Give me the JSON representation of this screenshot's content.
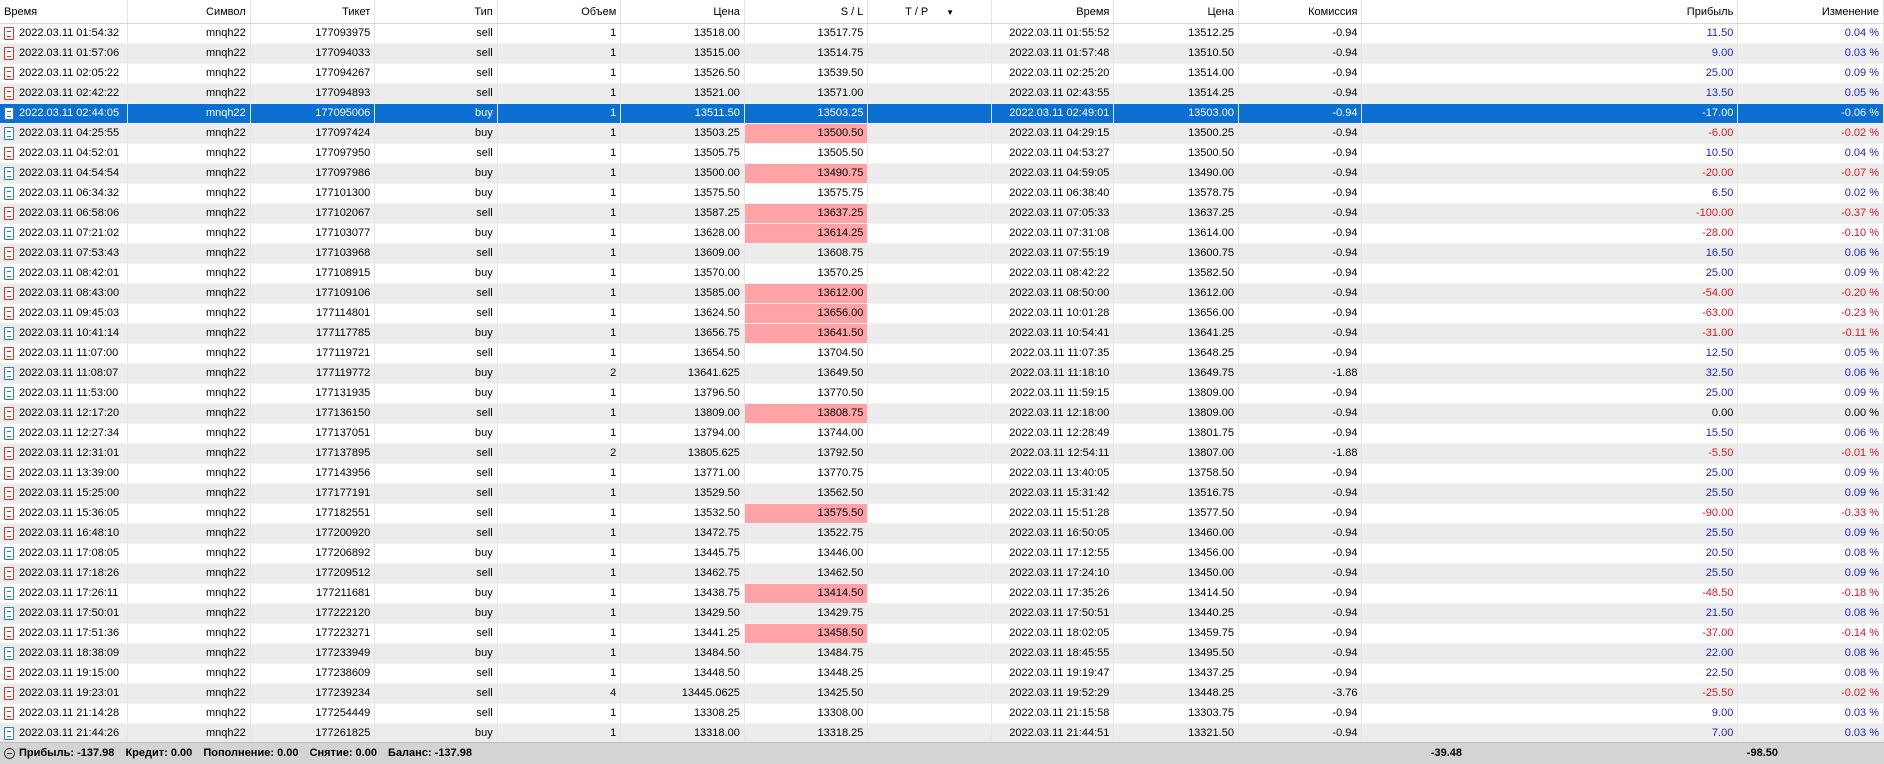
{
  "columns": [
    "Время",
    "Символ",
    "Тикет",
    "Тип",
    "Объем",
    "Цена",
    "S / L",
    "T / P",
    "Время",
    "Цена",
    "Комиссия",
    "Прибыль",
    "Изменение"
  ],
  "sort_indicator": "▼",
  "rows": [
    [
      "2022.03.11 01:54:32",
      "mnqh22",
      "177093975",
      "sell",
      "1",
      "13518.00",
      "13517.75",
      "",
      "2022.03.11 01:55:52",
      "13512.25",
      "-0.94",
      "11.50",
      "0.04 %"
    ],
    [
      "2022.03.11 01:57:06",
      "mnqh22",
      "177094033",
      "sell",
      "1",
      "13515.00",
      "13514.75",
      "",
      "2022.03.11 01:57:48",
      "13510.50",
      "-0.94",
      "9.00",
      "0.03 %"
    ],
    [
      "2022.03.11 02:05:22",
      "mnqh22",
      "177094267",
      "sell",
      "1",
      "13526.50",
      "13539.50",
      "",
      "2022.03.11 02:25:20",
      "13514.00",
      "-0.94",
      "25.00",
      "0.09 %"
    ],
    [
      "2022.03.11 02:42:22",
      "mnqh22",
      "177094893",
      "sell",
      "1",
      "13521.00",
      "13571.00",
      "",
      "2022.03.11 02:43:55",
      "13514.25",
      "-0.94",
      "13.50",
      "0.05 %"
    ],
    [
      "2022.03.11 02:44:05",
      "mnqh22",
      "177095006",
      "buy",
      "1",
      "13511.50",
      "13503.25",
      "",
      "2022.03.11 02:49:01",
      "13503.00",
      "-0.94",
      "-17.00",
      "-0.06 %"
    ],
    [
      "2022.03.11 04:25:55",
      "mnqh22",
      "177097424",
      "buy",
      "1",
      "13503.25",
      "13500.50",
      "",
      "2022.03.11 04:29:15",
      "13500.25",
      "-0.94",
      "-6.00",
      "-0.02 %"
    ],
    [
      "2022.03.11 04:52:01",
      "mnqh22",
      "177097950",
      "sell",
      "1",
      "13505.75",
      "13505.50",
      "",
      "2022.03.11 04:53:27",
      "13500.50",
      "-0.94",
      "10.50",
      "0.04 %"
    ],
    [
      "2022.03.11 04:54:54",
      "mnqh22",
      "177097986",
      "buy",
      "1",
      "13500.00",
      "13490.75",
      "",
      "2022.03.11 04:59:05",
      "13490.00",
      "-0.94",
      "-20.00",
      "-0.07 %"
    ],
    [
      "2022.03.11 06:34:32",
      "mnqh22",
      "177101300",
      "buy",
      "1",
      "13575.50",
      "13575.75",
      "",
      "2022.03.11 06:38:40",
      "13578.75",
      "-0.94",
      "6.50",
      "0.02 %"
    ],
    [
      "2022.03.11 06:58:06",
      "mnqh22",
      "177102067",
      "sell",
      "1",
      "13587.25",
      "13637.25",
      "",
      "2022.03.11 07:05:33",
      "13637.25",
      "-0.94",
      "-100.00",
      "-0.37 %"
    ],
    [
      "2022.03.11 07:21:02",
      "mnqh22",
      "177103077",
      "buy",
      "1",
      "13628.00",
      "13614.25",
      "",
      "2022.03.11 07:31:08",
      "13614.00",
      "-0.94",
      "-28.00",
      "-0.10 %"
    ],
    [
      "2022.03.11 07:53:43",
      "mnqh22",
      "177103968",
      "sell",
      "1",
      "13609.00",
      "13608.75",
      "",
      "2022.03.11 07:55:19",
      "13600.75",
      "-0.94",
      "16.50",
      "0.06 %"
    ],
    [
      "2022.03.11 08:42:01",
      "mnqh22",
      "177108915",
      "buy",
      "1",
      "13570.00",
      "13570.25",
      "",
      "2022.03.11 08:42:22",
      "13582.50",
      "-0.94",
      "25.00",
      "0.09 %"
    ],
    [
      "2022.03.11 08:43:00",
      "mnqh22",
      "177109106",
      "sell",
      "1",
      "13585.00",
      "13612.00",
      "",
      "2022.03.11 08:50:00",
      "13612.00",
      "-0.94",
      "-54.00",
      "-0.20 %"
    ],
    [
      "2022.03.11 09:45:03",
      "mnqh22",
      "177114801",
      "sell",
      "1",
      "13624.50",
      "13656.00",
      "",
      "2022.03.11 10:01:28",
      "13656.00",
      "-0.94",
      "-63.00",
      "-0.23 %"
    ],
    [
      "2022.03.11 10:41:14",
      "mnqh22",
      "177117785",
      "buy",
      "1",
      "13656.75",
      "13641.50",
      "",
      "2022.03.11 10:54:41",
      "13641.25",
      "-0.94",
      "-31.00",
      "-0.11 %"
    ],
    [
      "2022.03.11 11:07:00",
      "mnqh22",
      "177119721",
      "sell",
      "1",
      "13654.50",
      "13704.50",
      "",
      "2022.03.11 11:07:35",
      "13648.25",
      "-0.94",
      "12.50",
      "0.05 %"
    ],
    [
      "2022.03.11 11:08:07",
      "mnqh22",
      "177119772",
      "buy",
      "2",
      "13641.625",
      "13649.50",
      "",
      "2022.03.11 11:18:10",
      "13649.75",
      "-1.88",
      "32.50",
      "0.06 %"
    ],
    [
      "2022.03.11 11:53:00",
      "mnqh22",
      "177131935",
      "buy",
      "1",
      "13796.50",
      "13770.50",
      "",
      "2022.03.11 11:59:15",
      "13809.00",
      "-0.94",
      "25.00",
      "0.09 %"
    ],
    [
      "2022.03.11 12:17:20",
      "mnqh22",
      "177136150",
      "sell",
      "1",
      "13809.00",
      "13808.75",
      "",
      "2022.03.11 12:18:00",
      "13809.00",
      "-0.94",
      "0.00",
      "0.00 %"
    ],
    [
      "2022.03.11 12:27:34",
      "mnqh22",
      "177137051",
      "buy",
      "1",
      "13794.00",
      "13744.00",
      "",
      "2022.03.11 12:28:49",
      "13801.75",
      "-0.94",
      "15.50",
      "0.06 %"
    ],
    [
      "2022.03.11 12:31:01",
      "mnqh22",
      "177137895",
      "sell",
      "2",
      "13805.625",
      "13792.50",
      "",
      "2022.03.11 12:54:11",
      "13807.00",
      "-1.88",
      "-5.50",
      "-0.01 %"
    ],
    [
      "2022.03.11 13:39:00",
      "mnqh22",
      "177143956",
      "sell",
      "1",
      "13771.00",
      "13770.75",
      "",
      "2022.03.11 13:40:05",
      "13758.50",
      "-0.94",
      "25.00",
      "0.09 %"
    ],
    [
      "2022.03.11 15:25:00",
      "mnqh22",
      "177177191",
      "sell",
      "1",
      "13529.50",
      "13562.50",
      "",
      "2022.03.11 15:31:42",
      "13516.75",
      "-0.94",
      "25.50",
      "0.09 %"
    ],
    [
      "2022.03.11 15:36:05",
      "mnqh22",
      "177182551",
      "sell",
      "1",
      "13532.50",
      "13575.50",
      "",
      "2022.03.11 15:51:28",
      "13577.50",
      "-0.94",
      "-90.00",
      "-0.33 %"
    ],
    [
      "2022.03.11 16:48:10",
      "mnqh22",
      "177200920",
      "sell",
      "1",
      "13472.75",
      "13522.75",
      "",
      "2022.03.11 16:50:05",
      "13460.00",
      "-0.94",
      "25.50",
      "0.09 %"
    ],
    [
      "2022.03.11 17:08:05",
      "mnqh22",
      "177206892",
      "buy",
      "1",
      "13445.75",
      "13446.00",
      "",
      "2022.03.11 17:12:55",
      "13456.00",
      "-0.94",
      "20.50",
      "0.08 %"
    ],
    [
      "2022.03.11 17:18:26",
      "mnqh22",
      "177209512",
      "sell",
      "1",
      "13462.75",
      "13462.50",
      "",
      "2022.03.11 17:24:10",
      "13450.00",
      "-0.94",
      "25.50",
      "0.09 %"
    ],
    [
      "2022.03.11 17:26:11",
      "mnqh22",
      "177211681",
      "buy",
      "1",
      "13438.75",
      "13414.50",
      "",
      "2022.03.11 17:35:26",
      "13414.50",
      "-0.94",
      "-48.50",
      "-0.18 %"
    ],
    [
      "2022.03.11 17:50:01",
      "mnqh22",
      "177222120",
      "buy",
      "1",
      "13429.50",
      "13429.75",
      "",
      "2022.03.11 17:50:51",
      "13440.25",
      "-0.94",
      "21.50",
      "0.08 %"
    ],
    [
      "2022.03.11 17:51:36",
      "mnqh22",
      "177223271",
      "sell",
      "1",
      "13441.25",
      "13458.50",
      "",
      "2022.03.11 18:02:05",
      "13459.75",
      "-0.94",
      "-37.00",
      "-0.14 %"
    ],
    [
      "2022.03.11 18:38:09",
      "mnqh22",
      "177233949",
      "buy",
      "1",
      "13484.50",
      "13484.75",
      "",
      "2022.03.11 18:45:55",
      "13495.50",
      "-0.94",
      "22.00",
      "0.08 %"
    ],
    [
      "2022.03.11 19:15:00",
      "mnqh22",
      "177238609",
      "sell",
      "1",
      "13448.50",
      "13448.25",
      "",
      "2022.03.11 19:19:47",
      "13437.25",
      "-0.94",
      "22.50",
      "0.08 %"
    ],
    [
      "2022.03.11 19:23:01",
      "mnqh22",
      "177239234",
      "sell",
      "4",
      "13445.0625",
      "13425.50",
      "",
      "2022.03.11 19:52:29",
      "13448.25",
      "-3.76",
      "-25.50",
      "-0.02 %"
    ],
    [
      "2022.03.11 21:14:28",
      "mnqh22",
      "177254449",
      "sell",
      "1",
      "13308.25",
      "13308.00",
      "",
      "2022.03.11 21:15:58",
      "13303.75",
      "-0.94",
      "9.00",
      "0.03 %"
    ],
    [
      "2022.03.11 21:44:26",
      "mnqh22",
      "177261825",
      "buy",
      "1",
      "13318.00",
      "13318.25",
      "",
      "2022.03.11 21:44:51",
      "13321.50",
      "-0.94",
      "7.00",
      "0.03 %"
    ]
  ],
  "selected_row": 4,
  "sl_hit_rows": [
    5,
    7,
    9,
    10,
    13,
    14,
    15,
    19,
    24,
    28,
    30
  ],
  "summary": {
    "profit_label": "Прибыль:",
    "profit_value": "-137.98",
    "credit_label": "Кредит:",
    "credit_value": "0.00",
    "deposit_label": "Пополнение:",
    "deposit_value": "0.00",
    "withdrawal_label": "Снятие:",
    "withdrawal_value": "0.00",
    "balance_label": "Баланс:",
    "balance_value": "-137.98",
    "commission_total": "-39.48",
    "profit_total": "-98.50"
  },
  "colors": {
    "selected_bg": "#0a6fd1",
    "sl_hit_bg": "#ffa3a7",
    "profit_positive": "#1a1fd6",
    "profit_negative": "#e0141e",
    "row_alt_bg": "#ececec",
    "summary_bg": "#d4d4d4"
  },
  "icons": {
    "sell": "sell-order-icon",
    "buy": "buy-order-icon",
    "collapse": "collapse-minus-icon"
  }
}
